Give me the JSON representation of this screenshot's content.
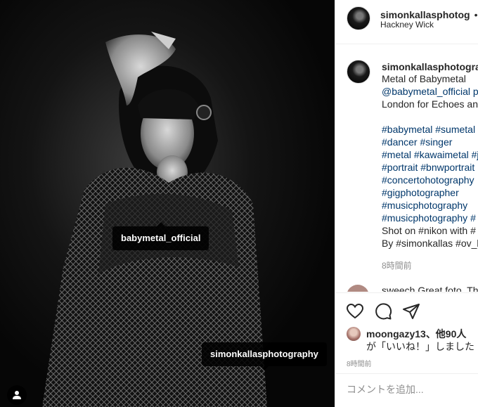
{
  "photo": {
    "tags": [
      "babymetal_official",
      "simonkallasphotography"
    ]
  },
  "header": {
    "username": "simonkallasphotog",
    "separator": "•",
    "follow": "フ",
    "location": "Hackney Wick"
  },
  "caption": {
    "username": "simonkallasphotograp",
    "lines": [
      "Metal of Babymetal",
      "@babymetal_official p",
      "London for Echoes and",
      "",
      "#babymetal #sumetal",
      "#dancer #singer",
      "#metal #kawaimetal #j",
      "#portrait #bnwportrait",
      "#concertohotography",
      "#gigphotographer",
      "#musicphotography",
      "#musicphotography #",
      "Shot on #nikon with #",
      "By #simonkallas #ov_k"
    ],
    "time": "8時間前"
  },
  "next_comment": {
    "text": "sweech Great foto. The"
  },
  "likes": {
    "user": "moongazy13",
    "others": "、他90人",
    "line2": "が「いいね！」しました"
  },
  "post": {
    "time": "8時間前"
  },
  "comment_input": {
    "placeholder": "コメントを追加..."
  },
  "icons": [
    "heart-icon",
    "comment-icon",
    "share-icon",
    "user-tag-icon"
  ]
}
